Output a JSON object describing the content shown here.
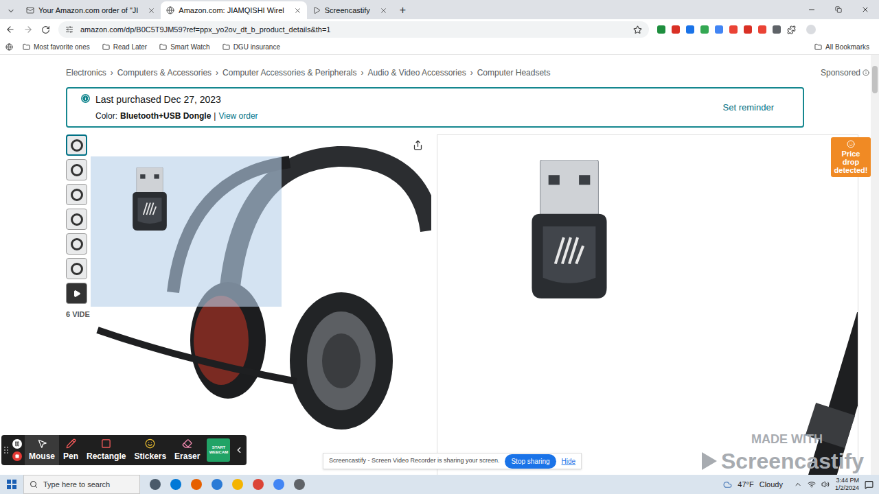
{
  "browser": {
    "tabs": [
      {
        "label": "Your Amazon.com order of \"JI",
        "selected": false
      },
      {
        "label": "Amazon.com: JIAMQISHI Wirel",
        "selected": true
      },
      {
        "label": "Screencastify",
        "selected": false
      }
    ],
    "new_tab": "+",
    "url": "amazon.com/dp/B0C5T9JM59?ref=ppx_yo2ov_dt_b_product_details&th=1",
    "bookmarks": [
      "Most favorite ones",
      "Read Later",
      "Smart Watch",
      "DGU insurance"
    ],
    "all_bookmarks": "All Bookmarks"
  },
  "page": {
    "breadcrumb": [
      "Electronics",
      "Computers & Accessories",
      "Computer Accessories & Peripherals",
      "Audio & Video Accessories",
      "Computer Headsets"
    ],
    "breadcrumb_separator": "›",
    "sponsored": "Sponsored",
    "purchase_notice": {
      "title": "Last purchased Dec 27, 2023",
      "color_label": "Color:",
      "color_value": "Bluetooth+USB Dongle",
      "separator": "|",
      "link": "View order",
      "reminder": "Set reminder"
    },
    "thumbnails": [
      {
        "kind": "image",
        "selected": true
      },
      {
        "kind": "image",
        "selected": false
      },
      {
        "kind": "image",
        "selected": false
      },
      {
        "kind": "image",
        "selected": false
      },
      {
        "kind": "image",
        "selected": false
      },
      {
        "kind": "image",
        "selected": false
      },
      {
        "kind": "video",
        "selected": false
      }
    ],
    "videos_label": "6 VIDE",
    "price_drop": "Price drop detected!"
  },
  "recorder_toolbar": {
    "tools": [
      {
        "label": "Mouse",
        "selected": true
      },
      {
        "label": "Pen",
        "selected": false
      },
      {
        "label": "Rectangle",
        "selected": false
      },
      {
        "label": "Stickers",
        "selected": false
      },
      {
        "label": "Eraser",
        "selected": false
      }
    ],
    "webcam": "START WEBCAM"
  },
  "share_bar": {
    "message": "Screencastify - Screen Video Recorder is sharing your screen.",
    "stop": "Stop sharing",
    "hide": "Hide"
  },
  "watermark": {
    "line1": "MADE WITH",
    "line2": "Screencastify"
  },
  "taskbar": {
    "search_placeholder": "Type here to search",
    "temperature": "47°F",
    "weather": "Cloudy",
    "time": "3:44 PM",
    "date": "1/2/2024"
  }
}
